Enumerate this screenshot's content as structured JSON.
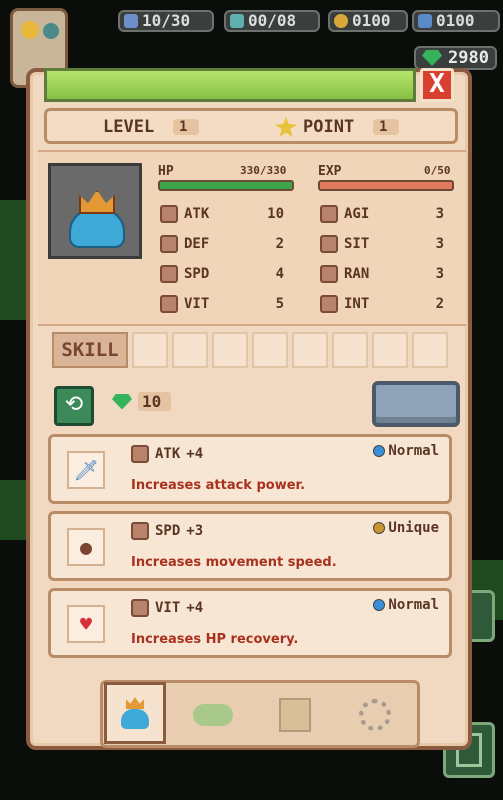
{
  "hud": {
    "attack_counter": "10/30",
    "chat_counter": "00/08",
    "coins": "0100",
    "scrolls": "0100",
    "gems": "2980"
  },
  "header": {
    "close_label": "X",
    "level_label": "LEVEL",
    "level_value": "1",
    "point_label": "POINT",
    "point_value": "1"
  },
  "stats": {
    "hp_label": "HP",
    "hp_value": "330/330",
    "hp_fraction": 1.0,
    "exp_label": "EXP",
    "exp_value": "0/50",
    "exp_fraction": 0.0,
    "left": [
      {
        "name": "ATK",
        "value": "10",
        "icon": "boot-stair-icon"
      },
      {
        "name": "DEF",
        "value": "2",
        "icon": "shield-icon"
      },
      {
        "name": "SPD",
        "value": "4",
        "icon": "boot-icon"
      },
      {
        "name": "VIT",
        "value": "5",
        "icon": "heart-icon"
      }
    ],
    "right": [
      {
        "name": "AGI",
        "value": "3",
        "icon": "agility-icon"
      },
      {
        "name": "SIT",
        "value": "3",
        "icon": "eye-icon"
      },
      {
        "name": "RAN",
        "value": "3",
        "icon": "range-icon"
      },
      {
        "name": "INT",
        "value": "2",
        "icon": "brain-icon"
      }
    ]
  },
  "skill": {
    "label": "SKILL",
    "slots": 8
  },
  "reroll": {
    "cost": "10"
  },
  "cards": [
    {
      "stat": "ATK",
      "bonus": "+4",
      "rarity": "Normal",
      "rarity_color": "#3a8fd6",
      "desc": "Increases attack power.",
      "icon": "sword-icon"
    },
    {
      "stat": "SPD",
      "bonus": "+3",
      "rarity": "Unique",
      "rarity_color": "#c8962e",
      "desc": "Increases movement speed.",
      "icon": "boot-icon"
    },
    {
      "stat": "VIT",
      "bonus": "+4",
      "rarity": "Normal",
      "rarity_color": "#3a8fd6",
      "desc": "Increases HP recovery.",
      "icon": "heart-icon"
    }
  ],
  "colors": {
    "panel": "#f0d9c0",
    "border": "#8a5b3e",
    "hp_bar": "#3ca44a",
    "exp_bar": "#e07a5f",
    "desc_text": "#a8321f"
  }
}
